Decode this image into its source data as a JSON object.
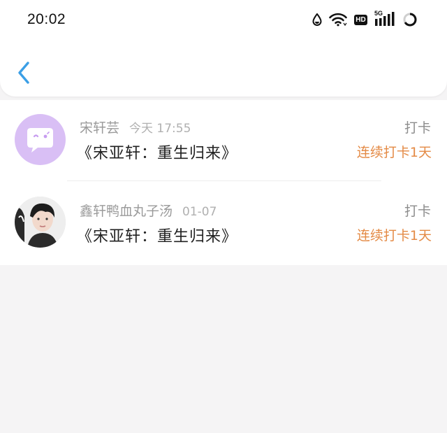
{
  "status_bar": {
    "time": "20:02",
    "icons": [
      "drop-icon",
      "wifi-icon",
      "hd-icon",
      "signal-5g-icon",
      "battery-ring-icon"
    ],
    "hd_label": "HD",
    "network_label": "5G"
  },
  "header": {
    "back_icon": "chevron-left-icon",
    "accent_color": "#3b9fe6"
  },
  "checkins": [
    {
      "user": "宋轩芸",
      "time": "今天 17:55",
      "title": "《宋亚轩：重生归来》",
      "action": "打卡",
      "streak": "连续打卡1天",
      "avatar": "default-chat-avatar",
      "avatar_color": "#d9bff5"
    },
    {
      "user": "鑫轩鸭血丸子汤",
      "time": "01-07",
      "title": "《宋亚轩：重生归来》",
      "action": "打卡",
      "streak": "连续打卡1天",
      "avatar": "user-photo-avatar"
    }
  ],
  "colors": {
    "streak": "#e48a45",
    "background": "#f5f4f5"
  }
}
